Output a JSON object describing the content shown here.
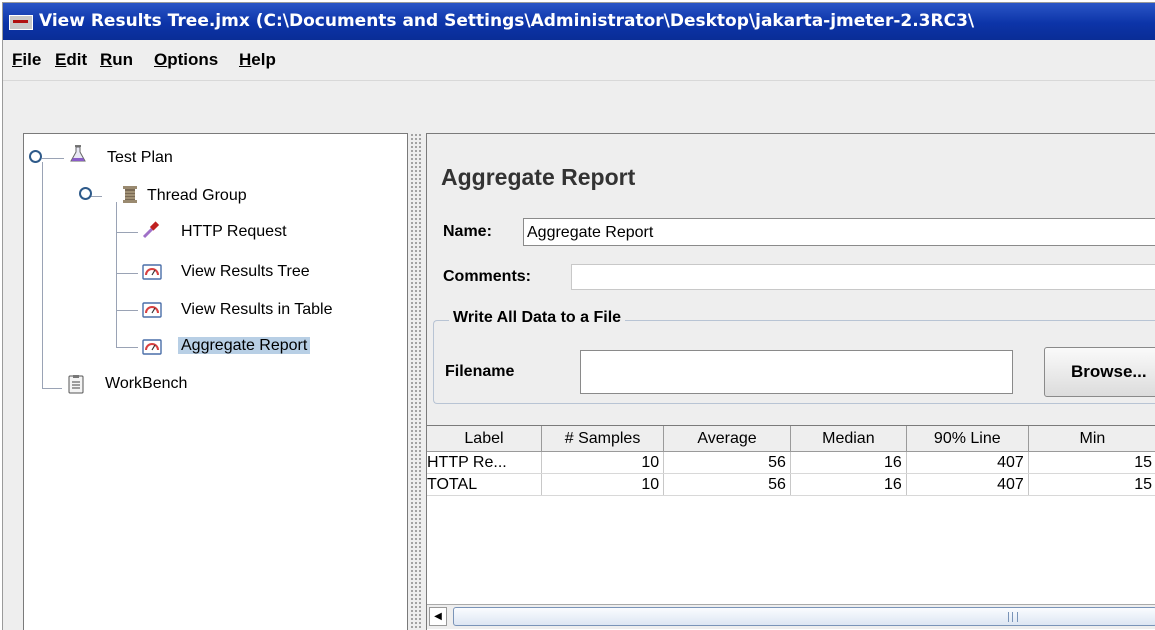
{
  "window": {
    "title": "View Results Tree.jmx (C:\\Documents and Settings\\Administrator\\Desktop\\jakarta-jmeter-2.3RC3\\"
  },
  "menu": [
    {
      "mnemonic": "F",
      "rest": "ile"
    },
    {
      "mnemonic": "E",
      "rest": "dit"
    },
    {
      "mnemonic": "R",
      "rest": "un"
    },
    {
      "mnemonic": "O",
      "rest": "ptions"
    },
    {
      "mnemonic": "H",
      "rest": "elp"
    }
  ],
  "tree": {
    "items": [
      {
        "label": "Test Plan",
        "icon": "flask-icon"
      },
      {
        "label": "Thread Group",
        "icon": "spool-icon"
      },
      {
        "label": "HTTP Request",
        "icon": "dropper-icon"
      },
      {
        "label": "View Results Tree",
        "icon": "gauge-icon"
      },
      {
        "label": "View Results in Table",
        "icon": "gauge-icon"
      },
      {
        "label": "Aggregate Report",
        "icon": "gauge-icon",
        "selected": true
      },
      {
        "label": "WorkBench",
        "icon": "clipboard-icon"
      }
    ]
  },
  "panel": {
    "title": "Aggregate Report",
    "name_label": "Name:",
    "name_value": "Aggregate Report",
    "comments_label": "Comments:",
    "comments_value": "",
    "file_group_title": "Write All Data to a File",
    "filename_label": "Filename",
    "filename_value": "",
    "browse_label": "Browse..."
  },
  "table": {
    "columns": [
      "Label",
      "# Samples",
      "Average",
      "Median",
      "90% Line",
      "Min"
    ],
    "rows": [
      [
        "HTTP Re...",
        "10",
        "56",
        "16",
        "407",
        "15"
      ],
      [
        "TOTAL",
        "10",
        "56",
        "16",
        "407",
        "15"
      ]
    ]
  },
  "colors": {
    "title_bar": "#0c34a8",
    "selection": "#b8cfe5",
    "window_bg": "#eeeeee"
  }
}
